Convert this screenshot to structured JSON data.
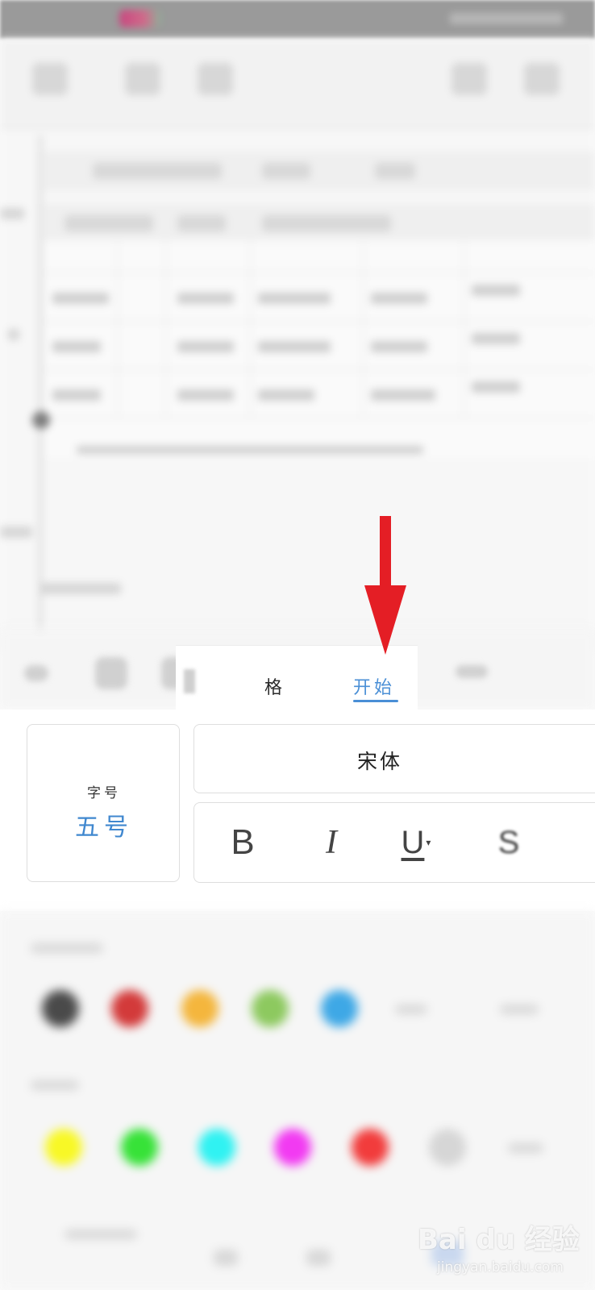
{
  "tabs": [
    {
      "label": "表格",
      "visible_label": "格"
    },
    {
      "label": "开始",
      "active": true
    }
  ],
  "font_size": {
    "title": "字号",
    "value": "五号"
  },
  "font_name": "宋体",
  "style_buttons": {
    "bold": "B",
    "italic": "I",
    "underline": "U"
  },
  "colors": {
    "accent": "#4a8fd6",
    "arrow": "#e41e25",
    "font_colors": [
      "#4a4a4a",
      "#d33a3a",
      "#f4b63d",
      "#8dc95f",
      "#3ea8e6"
    ],
    "highlight_colors": [
      "#f8f826",
      "#37e238",
      "#30f2f2",
      "#f23af2",
      "#f23c3c",
      "#d6d6d6"
    ]
  },
  "watermark": {
    "main": "Bai du 经验",
    "sub": "jingyan.baidu.com"
  }
}
